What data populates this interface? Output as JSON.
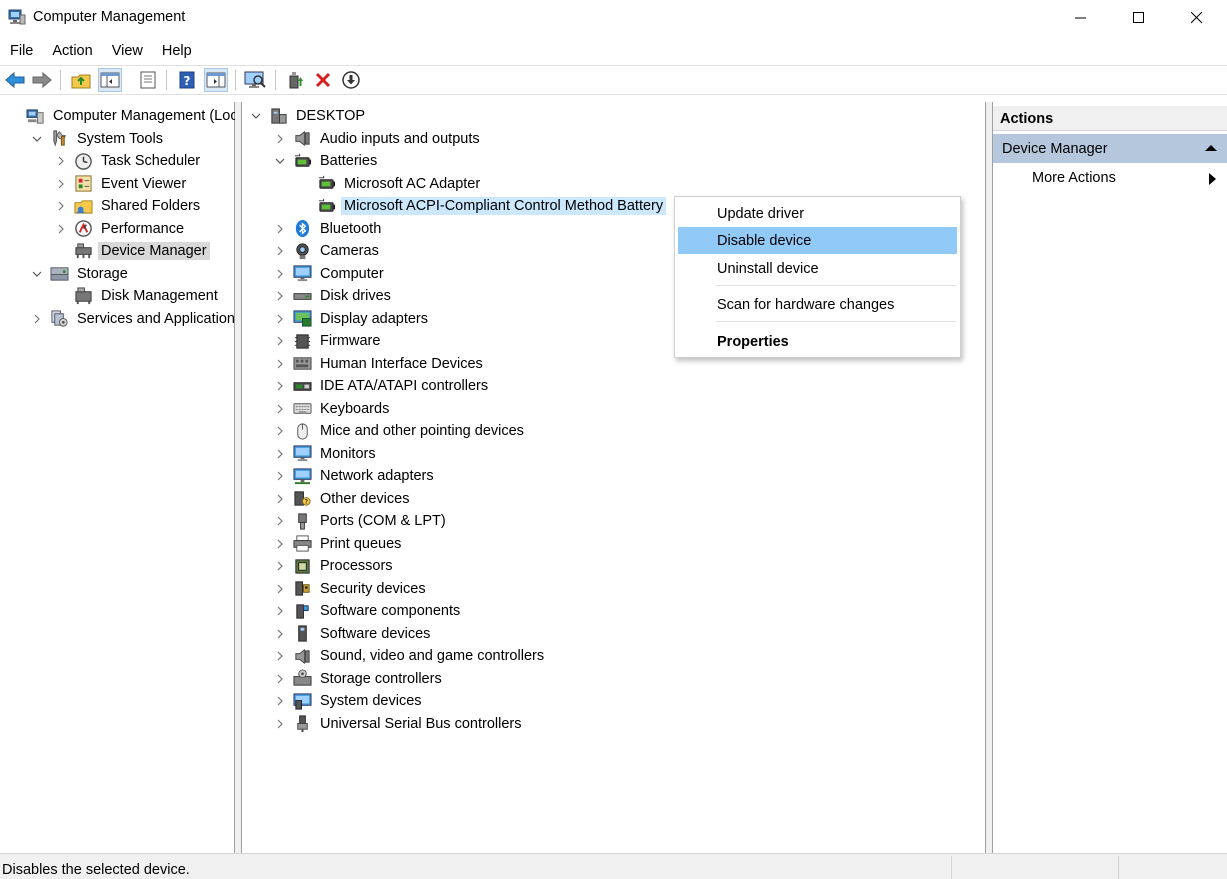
{
  "window": {
    "title": "Computer Management",
    "controls": [
      "minimize",
      "maximize",
      "close"
    ]
  },
  "menubar": [
    "File",
    "Action",
    "View",
    "Help"
  ],
  "toolbar": {
    "icons": [
      "back-arrow-icon",
      "forward-arrow-icon",
      "up-folder-icon",
      "show-hide-tree-icon",
      "properties-sheet-icon",
      "help-icon",
      "show-action-pane-icon",
      "scan-monitor-icon",
      "update-driver-icon",
      "uninstall-x-icon",
      "disable-download-icon"
    ]
  },
  "left_tree": [
    {
      "label": "Computer Management (Local)",
      "icon": "computer-management-icon",
      "level": 0,
      "chevron": "none"
    },
    {
      "label": "System Tools",
      "icon": "system-tools-icon",
      "level": 1,
      "chevron": "down"
    },
    {
      "label": "Task Scheduler",
      "icon": "clock-icon",
      "level": 2,
      "chevron": "right"
    },
    {
      "label": "Event Viewer",
      "icon": "event-viewer-icon",
      "level": 2,
      "chevron": "right"
    },
    {
      "label": "Shared Folders",
      "icon": "shared-folder-icon",
      "level": 2,
      "chevron": "right"
    },
    {
      "label": "Performance",
      "icon": "performance-icon",
      "level": 2,
      "chevron": "right"
    },
    {
      "label": "Device Manager",
      "icon": "device-manager-icon",
      "level": 2,
      "chevron": "none",
      "selected": true
    },
    {
      "label": "Storage",
      "icon": "storage-icon",
      "level": 1,
      "chevron": "down"
    },
    {
      "label": "Disk Management",
      "icon": "disk-management-icon",
      "level": 2,
      "chevron": "none"
    },
    {
      "label": "Services and Applications",
      "icon": "services-icon",
      "level": 1,
      "chevron": "right"
    }
  ],
  "device_tree": [
    {
      "label": "DESKTOP",
      "icon": "computer-node-icon",
      "level": 0,
      "chevron": "down"
    },
    {
      "label": "Audio inputs and outputs",
      "icon": "speaker-icon",
      "level": 1,
      "chevron": "right"
    },
    {
      "label": "Batteries",
      "icon": "battery-icon",
      "level": 1,
      "chevron": "down"
    },
    {
      "label": "Microsoft AC Adapter",
      "icon": "battery-icon",
      "level": 2,
      "chevron": "none"
    },
    {
      "label": "Microsoft ACPI-Compliant Control Method Battery",
      "icon": "battery-icon",
      "level": 2,
      "chevron": "none",
      "highlight": true
    },
    {
      "label": "Bluetooth",
      "icon": "bluetooth-icon",
      "level": 1,
      "chevron": "right"
    },
    {
      "label": "Cameras",
      "icon": "camera-icon",
      "level": 1,
      "chevron": "right"
    },
    {
      "label": "Computer",
      "icon": "monitor-icon",
      "level": 1,
      "chevron": "right"
    },
    {
      "label": "Disk drives",
      "icon": "disk-drive-icon",
      "level": 1,
      "chevron": "right"
    },
    {
      "label": "Display adapters",
      "icon": "display-adapter-icon",
      "level": 1,
      "chevron": "right"
    },
    {
      "label": "Firmware",
      "icon": "chip-icon",
      "level": 1,
      "chevron": "right"
    },
    {
      "label": "Human Interface Devices",
      "icon": "hid-icon",
      "level": 1,
      "chevron": "right"
    },
    {
      "label": "IDE ATA/ATAPI controllers",
      "icon": "ide-controller-icon",
      "level": 1,
      "chevron": "right"
    },
    {
      "label": "Keyboards",
      "icon": "keyboard-icon",
      "level": 1,
      "chevron": "right"
    },
    {
      "label": "Mice and other pointing devices",
      "icon": "mouse-icon",
      "level": 1,
      "chevron": "right"
    },
    {
      "label": "Monitors",
      "icon": "monitor-icon",
      "level": 1,
      "chevron": "right"
    },
    {
      "label": "Network adapters",
      "icon": "network-adapter-icon",
      "level": 1,
      "chevron": "right"
    },
    {
      "label": "Other devices",
      "icon": "other-device-icon",
      "level": 1,
      "chevron": "right"
    },
    {
      "label": "Ports (COM & LPT)",
      "icon": "port-icon",
      "level": 1,
      "chevron": "right"
    },
    {
      "label": "Print queues",
      "icon": "printer-icon",
      "level": 1,
      "chevron": "right"
    },
    {
      "label": "Processors",
      "icon": "processor-icon",
      "level": 1,
      "chevron": "right"
    },
    {
      "label": "Security devices",
      "icon": "security-device-icon",
      "level": 1,
      "chevron": "right"
    },
    {
      "label": "Software components",
      "icon": "software-component-icon",
      "level": 1,
      "chevron": "right"
    },
    {
      "label": "Software devices",
      "icon": "software-device-icon",
      "level": 1,
      "chevron": "right"
    },
    {
      "label": "Sound, video and game controllers",
      "icon": "speaker-icon",
      "level": 1,
      "chevron": "right"
    },
    {
      "label": "Storage controllers",
      "icon": "storage-controller-icon",
      "level": 1,
      "chevron": "right"
    },
    {
      "label": "System devices",
      "icon": "system-device-icon",
      "level": 1,
      "chevron": "right"
    },
    {
      "label": "Universal Serial Bus controllers",
      "icon": "usb-icon",
      "level": 1,
      "chevron": "right"
    }
  ],
  "context_menu": {
    "items": [
      {
        "label": "Update driver"
      },
      {
        "label": "Disable device",
        "hover": true
      },
      {
        "label": "Uninstall device"
      },
      {
        "label": "Scan for hardware changes"
      },
      {
        "label": "Properties",
        "bold": true
      }
    ]
  },
  "actions": {
    "header": "Actions",
    "section": "Device Manager",
    "more": "More Actions"
  },
  "statusbar": {
    "message": "Disables the selected device."
  },
  "colors": {
    "selection_gray": "#d9d9d9",
    "highlight_blue": "#cce8ff",
    "menu_hover": "#91c9f7",
    "actions_section": "#b4c7dd"
  }
}
